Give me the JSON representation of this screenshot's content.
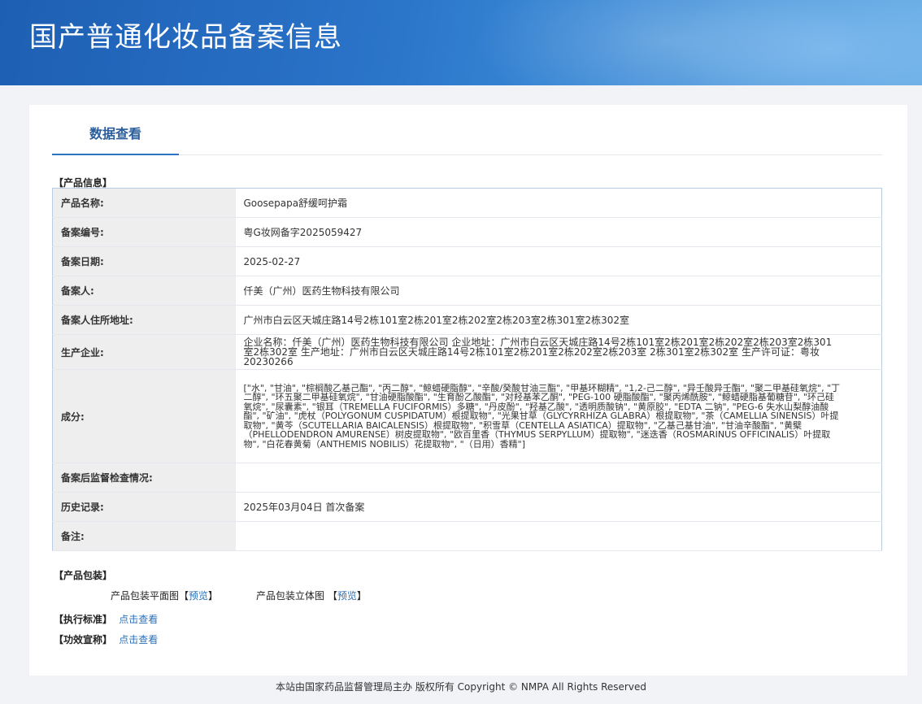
{
  "header": {
    "title": "国产普通化妆品备案信息"
  },
  "tabs": {
    "active_label": "数据查看"
  },
  "product_info": {
    "section_label": "【产品信息】",
    "rows": [
      {
        "key": "产品名称:",
        "value": "Goosepapa舒缓呵护霜"
      },
      {
        "key": "备案编号:",
        "value": "粤G妆网备字2025059427"
      },
      {
        "key": "备案日期:",
        "value": "2025-02-27"
      },
      {
        "key": "备案人:",
        "value": "仟美（广州）医药生物科技有限公司"
      },
      {
        "key": "备案人住所地址:",
        "value": "广州市白云区天城庄路14号2栋101室2栋201室2栋202室2栋203室2栋301室2栋302室"
      },
      {
        "key": "生产企业:",
        "value": "企业名称：仟美（广州）医药生物科技有限公司 企业地址：广州市白云区天城庄路14号2栋101室2栋201室2栋202室2栋203室2栋301室2栋302室 生产地址：广州市白云区天城庄路14号2栋101室2栋201室2栋202室2栋203室 2栋301室2栋302室 生产许可证：粤妆20230266"
      },
      {
        "key": "成分:",
        "value": "[\"水\", \"甘油\", \"棕榈酸乙基己酯\", \"丙二醇\", \"鲸蜡硬脂醇\", \"辛酸/癸酸甘油三酯\", \"甲基环糊精\", \"1,2-己二醇\", \"异壬酸异壬酯\", \"聚二甲基硅氧烷\", \"丁二醇\", \"环五聚二甲基硅氧烷\", \"甘油硬脂酸酯\", \"生育酚乙酸酯\", \"对羟基苯乙酮\", \"PEG-100 硬脂酸酯\", \"聚丙烯酰胺\", \"鲸蜡硬脂基葡糖苷\", \"环己硅氧烷\", \"尿囊素\", \"银耳（TREMELLA FUCIFORMIS）多糖\", \"丹皮酚\", \"羟基乙酸\", \"透明质酸钠\", \"黄原胶\", \"EDTA 二钠\", \"PEG-6 失水山梨醇油酸酯\", \"矿油\", \"虎杖（POLYGONUM CUSPIDATUM）根提取物\", \"光果甘草（GLYCYRRHIZA GLABRA）根提取物\", \"茶（CAMELLIA SINENSIS）叶提取物\", \"黄芩（SCUTELLARIA BAICALENSIS）根提取物\", \"积雪草（CENTELLA ASIATICA）提取物\", \"乙基己基甘油\", \"甘油辛酸酯\", \"黄檗（PHELLODENDRON AMURENSE）树皮提取物\", \"欧百里香（THYMUS SERPYLLUM）提取物\", \"迷迭香（ROSMARINUS OFFICINALIS）叶提取物\", \"白花春黄菊（ANTHEMIS NOBILIS）花提取物\", \"（日用）香精\"]"
      },
      {
        "key": "备案后监督检查情况:",
        "value": ""
      },
      {
        "key": "历史记录:",
        "value": "2025年03月04日 首次备案"
      },
      {
        "key": "备注:",
        "value": ""
      }
    ]
  },
  "packaging": {
    "section_label": "【产品包装】",
    "flat_label": "产品包装平面图",
    "stereo_label": "产品包装立体图",
    "bracket_open": "【",
    "bracket_close": "】",
    "preview_link": "预览"
  },
  "standards": {
    "label": "【执行标准】",
    "link": "点击查看"
  },
  "efficacy": {
    "label": "【功效宣称】",
    "link": "点击查看"
  },
  "footer": {
    "text": "本站由国家药品监督管理局主办 版权所有 Copyright © NMPA All Rights Reserved"
  },
  "colors": {
    "accent": "#2b73c6",
    "link": "#2b6fb8",
    "banner": "#2a73c8"
  }
}
